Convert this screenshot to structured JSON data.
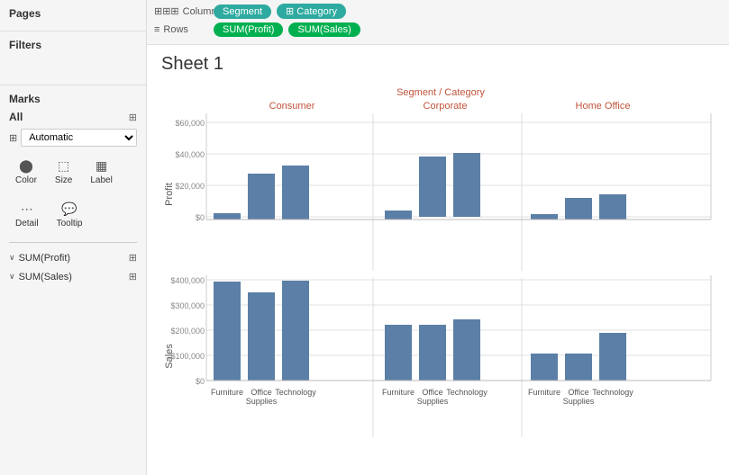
{
  "leftPanel": {
    "pages_label": "Pages",
    "filters_label": "Filters",
    "marks_label": "Marks",
    "marks_all_label": "All",
    "dropdown_label": "Automatic",
    "color_btn": "Color",
    "size_btn": "Size",
    "label_btn": "Label",
    "detail_btn": "Detail",
    "tooltip_btn": "Tooltip",
    "measure1_label": "SUM(Profit)",
    "measure2_label": "SUM(Sales)"
  },
  "pills": {
    "columns_icon": "⊞",
    "columns_label": "Columns",
    "rows_icon": "≡",
    "rows_label": "Rows",
    "segment_pill": "Segment",
    "category_pill": "⊞ Category",
    "sum_profit_pill": "SUM(Profit)",
    "sum_sales_pill": "SUM(Sales)"
  },
  "sheet": {
    "title": "Sheet 1"
  },
  "chart": {
    "legend_title": "Segment / Category",
    "segments": [
      "Consumer",
      "Corporate",
      "Home Office"
    ],
    "x_labels_consumer": [
      "Furniture",
      "Office\nSupplies",
      "Technology"
    ],
    "x_labels_corporate": [
      "Furniture",
      "Office\nSupplies",
      "Technology"
    ],
    "x_labels_homeoffice": [
      "Furniture",
      "Office\nSupplies",
      "Technology"
    ],
    "profit_y_labels": [
      "$60,000",
      "$40,000",
      "$20,000",
      "$0"
    ],
    "sales_y_labels": [
      "$400,000",
      "$300,000",
      "$200,000",
      "$100,000",
      "$0"
    ],
    "profit_axis": "Profit",
    "sales_axis": "Sales"
  },
  "colors": {
    "pill_teal": "#2eaaa0",
    "pill_green": "#00b050",
    "bar_blue": "#5b7fa6",
    "segment_label": "#c0543c",
    "axis_label": "#888"
  }
}
